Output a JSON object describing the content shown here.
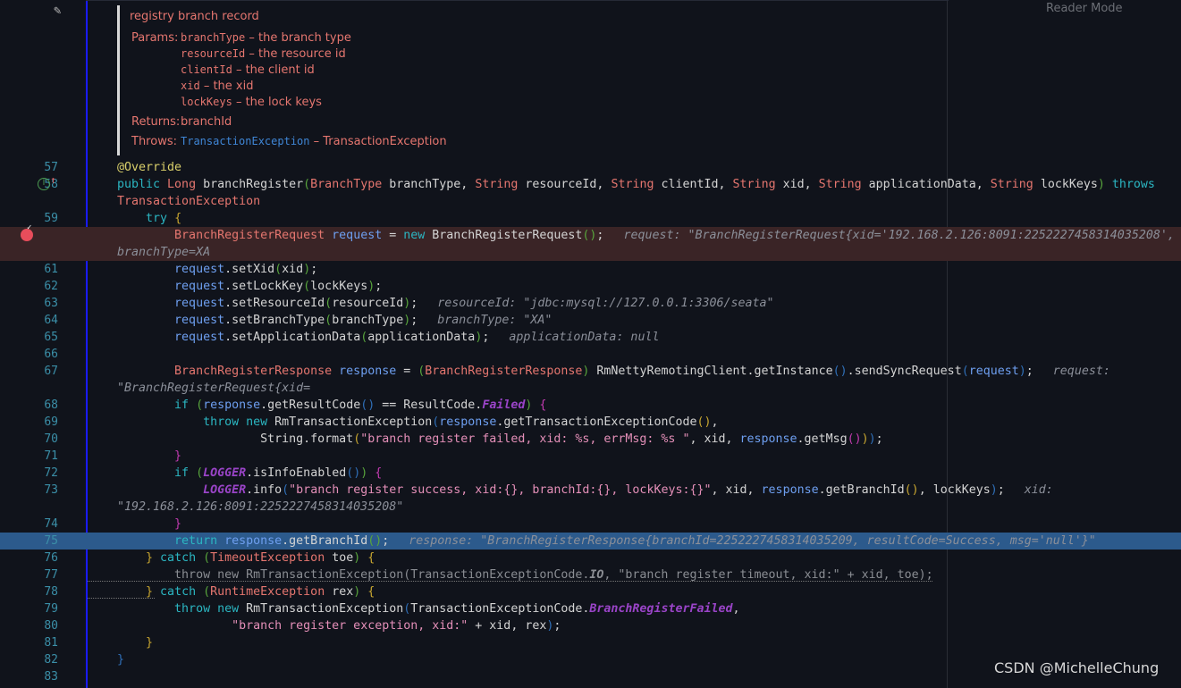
{
  "toolbar": {
    "reader_mode": "Reader Mode"
  },
  "watermark": "CSDN @MichelleChung",
  "doc": {
    "summary": "registry branch record",
    "params_label": "Params:",
    "params": [
      {
        "name": "branchType",
        "desc": "– the branch type"
      },
      {
        "name": "resourceId",
        "desc": "– the resource id"
      },
      {
        "name": "clientId",
        "desc": "– the client id"
      },
      {
        "name": "xid",
        "desc": "– the xid"
      },
      {
        "name": "lockKeys",
        "desc": "– the lock keys"
      }
    ],
    "returns_label": "Returns:",
    "returns": "branchId",
    "throws_label": "Throws:",
    "throws_type": "TransactionException",
    "throws_desc": "– TransactionException"
  },
  "gutter_icons": {
    "58": "override-implements-icon",
    "60": "breakpoint-icon"
  },
  "lines": [
    {
      "n": "57",
      "tokens": [
        [
          "a",
          "@Override"
        ]
      ]
    },
    {
      "n": "58",
      "tokens": [
        [
          "k",
          "public "
        ],
        [
          "t",
          "Long "
        ],
        [
          "p",
          "branchRegister"
        ],
        [
          "g",
          "("
        ],
        [
          "t",
          "BranchType "
        ],
        [
          "p",
          "branchType, "
        ],
        [
          "t",
          "String "
        ],
        [
          "p",
          "resourceId, "
        ],
        [
          "t",
          "String "
        ],
        [
          "p",
          "clientId, "
        ],
        [
          "t",
          "String "
        ],
        [
          "p",
          "xid, "
        ],
        [
          "t",
          "String "
        ],
        [
          "p",
          "applicationData, "
        ],
        [
          "t",
          "String "
        ],
        [
          "p",
          "lockKeys"
        ],
        [
          "g",
          ")"
        ],
        [
          "k",
          " throws "
        ],
        [
          "t",
          "TransactionException"
        ]
      ]
    },
    {
      "n": "59",
      "tokens": [
        [
          "p",
          "    "
        ],
        [
          "k",
          "try "
        ],
        [
          "y",
          "{"
        ]
      ]
    },
    {
      "n": "60",
      "bp": true,
      "tokens": [
        [
          "p",
          "        "
        ],
        [
          "t",
          "BranchRegisterRequest "
        ],
        [
          "v",
          "request"
        ],
        [
          "p",
          " = "
        ],
        [
          "k",
          "new "
        ],
        [
          "p",
          "BranchRegisterRequest"
        ],
        [
          "g",
          "()"
        ],
        [
          "p",
          ";"
        ],
        [
          "h",
          "request: \"BranchRegisterRequest{xid='192.168.2.126:8091:2252227458314035208', branchType=XA"
        ]
      ]
    },
    {
      "n": "61",
      "tokens": [
        [
          "p",
          "        "
        ],
        [
          "v",
          "request"
        ],
        [
          "p",
          ".setXid"
        ],
        [
          "g",
          "("
        ],
        [
          "p",
          "xid"
        ],
        [
          "g",
          ")"
        ],
        [
          "p",
          ";"
        ]
      ]
    },
    {
      "n": "62",
      "tokens": [
        [
          "p",
          "        "
        ],
        [
          "v",
          "request"
        ],
        [
          "p",
          ".setLockKey"
        ],
        [
          "g",
          "("
        ],
        [
          "p",
          "lockKeys"
        ],
        [
          "g",
          ")"
        ],
        [
          "p",
          ";"
        ]
      ]
    },
    {
      "n": "63",
      "tokens": [
        [
          "p",
          "        "
        ],
        [
          "v",
          "request"
        ],
        [
          "p",
          ".setResourceId"
        ],
        [
          "g",
          "("
        ],
        [
          "p",
          "resourceId"
        ],
        [
          "g",
          ")"
        ],
        [
          "p",
          ";"
        ],
        [
          "h",
          "resourceId: \"jdbc:mysql://127.0.0.1:3306/seata\""
        ]
      ]
    },
    {
      "n": "64",
      "tokens": [
        [
          "p",
          "        "
        ],
        [
          "v",
          "request"
        ],
        [
          "p",
          ".setBranchType"
        ],
        [
          "g",
          "("
        ],
        [
          "p",
          "branchType"
        ],
        [
          "g",
          ")"
        ],
        [
          "p",
          ";"
        ],
        [
          "h",
          "branchType: \"XA\""
        ]
      ]
    },
    {
      "n": "65",
      "tokens": [
        [
          "p",
          "        "
        ],
        [
          "v",
          "request"
        ],
        [
          "p",
          ".setApplicationData"
        ],
        [
          "g",
          "("
        ],
        [
          "p",
          "applicationData"
        ],
        [
          "g",
          ")"
        ],
        [
          "p",
          ";"
        ],
        [
          "h",
          "applicationData: null"
        ]
      ]
    },
    {
      "n": "66",
      "tokens": []
    },
    {
      "n": "67",
      "tokens": [
        [
          "p",
          "        "
        ],
        [
          "t",
          "BranchRegisterResponse "
        ],
        [
          "v",
          "response"
        ],
        [
          "p",
          " = "
        ],
        [
          "g",
          "("
        ],
        [
          "t",
          "BranchRegisterResponse"
        ],
        [
          "g",
          ")"
        ],
        [
          "p",
          " RmNettyRemotingClient.getInstance"
        ],
        [
          "b",
          "()"
        ],
        [
          "p",
          ".sendSyncRequest"
        ],
        [
          "b",
          "("
        ],
        [
          "v",
          "request"
        ],
        [
          "b",
          ")"
        ],
        [
          "p",
          ";"
        ],
        [
          "h",
          "request: \"BranchRegisterRequest{xid="
        ]
      ]
    },
    {
      "n": "68",
      "tokens": [
        [
          "p",
          "        "
        ],
        [
          "k",
          "if "
        ],
        [
          "g",
          "("
        ],
        [
          "v",
          "response"
        ],
        [
          "p",
          ".getResultCode"
        ],
        [
          "b",
          "()"
        ],
        [
          "p",
          " == ResultCode."
        ],
        [
          "c",
          "Failed"
        ],
        [
          "g",
          ")"
        ],
        [
          "p",
          " "
        ],
        [
          "m",
          "{"
        ]
      ]
    },
    {
      "n": "69",
      "tokens": [
        [
          "p",
          "            "
        ],
        [
          "k",
          "throw new "
        ],
        [
          "p",
          "RmTransactionException"
        ],
        [
          "b",
          "("
        ],
        [
          "v",
          "response"
        ],
        [
          "p",
          ".getTransactionExceptionCode"
        ],
        [
          "y",
          "()"
        ],
        [
          "p",
          ","
        ]
      ]
    },
    {
      "n": "70",
      "tokens": [
        [
          "p",
          "                    String.format"
        ],
        [
          "y",
          "("
        ],
        [
          "s",
          "\"branch register failed, xid: %s, errMsg: %s \""
        ],
        [
          "p",
          ", xid, "
        ],
        [
          "v",
          "response"
        ],
        [
          "p",
          ".getMsg"
        ],
        [
          "m",
          "()"
        ],
        [
          "y",
          ")"
        ],
        [
          "b",
          ")"
        ],
        [
          "p",
          ";"
        ]
      ]
    },
    {
      "n": "71",
      "tokens": [
        [
          "p",
          "        "
        ],
        [
          "m",
          "}"
        ]
      ]
    },
    {
      "n": "72",
      "tokens": [
        [
          "p",
          "        "
        ],
        [
          "k",
          "if "
        ],
        [
          "g",
          "("
        ],
        [
          "c",
          "LOGGER"
        ],
        [
          "p",
          ".isInfoEnabled"
        ],
        [
          "b",
          "()"
        ],
        [
          "g",
          ")"
        ],
        [
          "p",
          " "
        ],
        [
          "m",
          "{"
        ]
      ]
    },
    {
      "n": "73",
      "tokens": [
        [
          "p",
          "            "
        ],
        [
          "c",
          "LOGGER"
        ],
        [
          "p",
          ".info"
        ],
        [
          "b",
          "("
        ],
        [
          "s",
          "\"branch register success, xid:{}, branchId:{}, lockKeys:{}\""
        ],
        [
          "p",
          ", xid, "
        ],
        [
          "v",
          "response"
        ],
        [
          "p",
          ".getBranchId"
        ],
        [
          "y",
          "()"
        ],
        [
          "p",
          ", lockKeys"
        ],
        [
          "b",
          ")"
        ],
        [
          "p",
          ";"
        ],
        [
          "h",
          "xid: \"192.168.2.126:8091:2252227458314035208\""
        ]
      ]
    },
    {
      "n": "74",
      "tokens": [
        [
          "p",
          "        "
        ],
        [
          "m",
          "}"
        ]
      ]
    },
    {
      "n": "75",
      "sel": true,
      "tokens": [
        [
          "p",
          "        "
        ],
        [
          "k",
          "return "
        ],
        [
          "v",
          "response"
        ],
        [
          "p",
          ".getBranchId"
        ],
        [
          "g",
          "()"
        ],
        [
          "p",
          ";"
        ],
        [
          "h",
          "response: \"BranchRegisterResponse{branchId=2252227458314035209, resultCode=Success, msg='null'}\""
        ]
      ]
    },
    {
      "n": "76",
      "tokens": [
        [
          "p",
          "    "
        ],
        [
          "y",
          "}"
        ],
        [
          "k",
          " catch "
        ],
        [
          "g",
          "("
        ],
        [
          "t",
          "TimeoutException "
        ],
        [
          "p",
          "toe"
        ],
        [
          "g",
          ")"
        ],
        [
          "p",
          " "
        ],
        [
          "y",
          "{"
        ]
      ]
    },
    {
      "n": "77",
      "dim": true,
      "tokens": [
        [
          "p",
          "        throw new RmTransactionException(TransactionExceptionCode."
        ],
        [
          "c",
          "IO"
        ],
        [
          "p",
          ", \"branch register timeout, xid:\" + xid, toe);"
        ]
      ]
    },
    {
      "n": "78",
      "tokens": [
        [
          "p",
          "    "
        ],
        [
          "y",
          "}"
        ],
        [
          "k",
          " catch "
        ],
        [
          "g",
          "("
        ],
        [
          "t",
          "RuntimeException "
        ],
        [
          "p",
          "rex"
        ],
        [
          "g",
          ")"
        ],
        [
          "p",
          " "
        ],
        [
          "y",
          "{"
        ]
      ]
    },
    {
      "n": "79",
      "tokens": [
        [
          "p",
          "        "
        ],
        [
          "k",
          "throw new "
        ],
        [
          "p",
          "RmTransactionException"
        ],
        [
          "b",
          "("
        ],
        [
          "p",
          "TransactionExceptionCode."
        ],
        [
          "c",
          "BranchRegisterFailed"
        ],
        [
          "p",
          ","
        ]
      ]
    },
    {
      "n": "80",
      "tokens": [
        [
          "p",
          "                "
        ],
        [
          "s",
          "\"branch register exception, xid:\""
        ],
        [
          "p",
          " + xid, rex"
        ],
        [
          "b",
          ")"
        ],
        [
          "p",
          ";"
        ]
      ]
    },
    {
      "n": "81",
      "tokens": [
        [
          "p",
          "    "
        ],
        [
          "y",
          "}"
        ]
      ]
    },
    {
      "n": "82",
      "tokens": [
        [
          "b",
          "}"
        ]
      ]
    },
    {
      "n": "83",
      "tokens": []
    }
  ]
}
